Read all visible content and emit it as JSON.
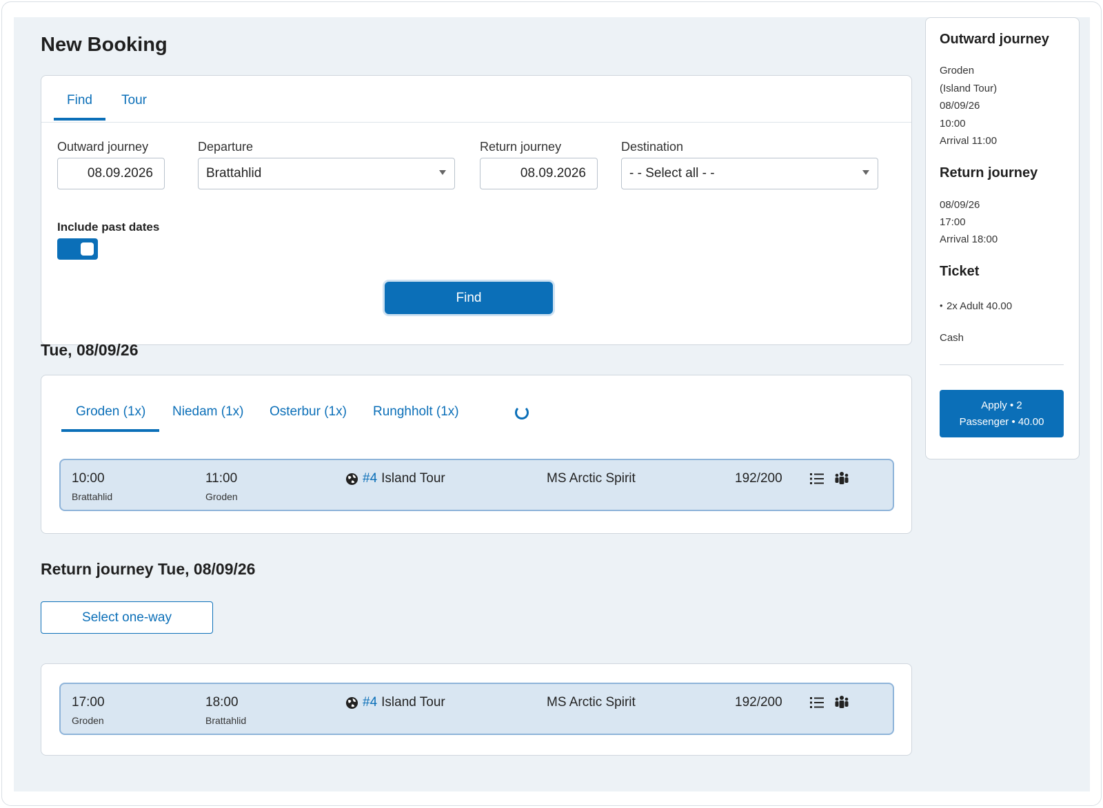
{
  "page": {
    "title": "New Booking"
  },
  "search": {
    "tabs": [
      "Find",
      "Tour"
    ],
    "outward_label": "Outward journey",
    "outward_value": "08.09.2026",
    "departure_label": "Departure",
    "departure_value": "Brattahlid",
    "return_label": "Return journey",
    "return_value": "08.09.2026",
    "destination_label": "Destination",
    "destination_value": "- - Select all - -",
    "past_dates_label": "Include past dates",
    "past_dates_enabled": true,
    "find_button": "Find"
  },
  "outward": {
    "heading": "Tue, 08/09/26",
    "route_tabs": [
      "Groden (1x)",
      "Niedam (1x)",
      "Osterbur (1x)",
      "Runghholt (1x)"
    ],
    "trip": {
      "depart_time": "10:00",
      "depart_place": "Brattahlid",
      "arrive_time": "11:00",
      "arrive_place": "Groden",
      "tour_number": "#4",
      "tour_name": "Island Tour",
      "ship": "MS Arctic Spirit",
      "capacity": "192/200",
      "icons": [
        "globe-icon",
        "list-icon",
        "passengers-icon"
      ]
    }
  },
  "return": {
    "heading": "Return journey Tue, 08/09/26",
    "oneway_button": "Select one-way",
    "trip": {
      "depart_time": "17:00",
      "depart_place": "Groden",
      "arrive_time": "18:00",
      "arrive_place": "Brattahlid",
      "tour_number": "#4",
      "tour_name": "Island Tour",
      "ship": "MS Arctic Spirit",
      "capacity": "192/200"
    }
  },
  "summary": {
    "outward_heading": "Outward journey",
    "outward_lines": [
      "Groden",
      "(Island Tour)",
      "08/09/26",
      "10:00",
      "Arrival 11:00"
    ],
    "return_heading": "Return journey",
    "return_lines": [
      "08/09/26",
      "17:00",
      "Arrival 18:00"
    ],
    "ticket_heading": "Ticket",
    "ticket_item": "2x Adult 40.00",
    "payment": "Cash",
    "apply_line1": "Apply • 2",
    "apply_line2": "Passenger • 40.00"
  },
  "colors": {
    "accent": "#0b6fb8",
    "row_bg": "#d9e6f2",
    "canvas_bg": "#edf2f6"
  }
}
